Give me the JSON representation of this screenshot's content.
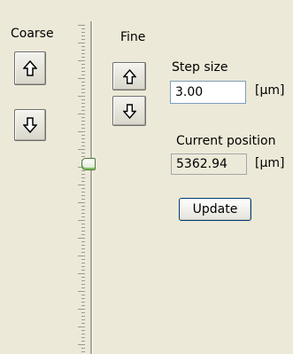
{
  "coarse": {
    "label": "Coarse",
    "up_icon": "arrow-up-icon",
    "down_icon": "arrow-down-icon"
  },
  "fine": {
    "label": "Fine",
    "up_icon": "arrow-up-icon",
    "down_icon": "arrow-down-icon"
  },
  "step_size": {
    "label": "Step size",
    "value": "3.00",
    "unit": "[µm]"
  },
  "current_position": {
    "label": "Current position",
    "value": "5362.94",
    "unit": "[µm]"
  },
  "update_button": {
    "label": "Update"
  },
  "colors": {
    "panel_background": "#ece9d8",
    "thumb_accent": "#7fbf5f",
    "textbox_border": "#7f9db9"
  }
}
